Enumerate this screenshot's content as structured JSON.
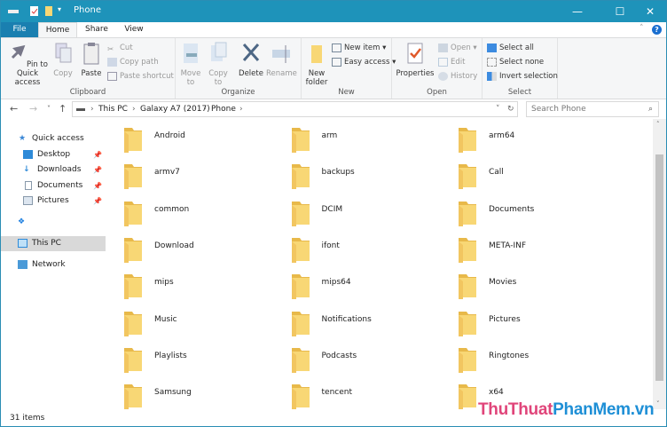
{
  "window": {
    "title": "Phone",
    "minimize": "—",
    "maximize": "☐",
    "close": "✕"
  },
  "ribbon_tabs": [
    "File",
    "Home",
    "Share",
    "View"
  ],
  "clipboard": {
    "group": "Clipboard",
    "pin": "Pin to Quick access",
    "copy": "Copy",
    "paste": "Paste",
    "cut": "Cut",
    "copy_path": "Copy path",
    "paste_shortcut": "Paste shortcut"
  },
  "organize": {
    "group": "Organize",
    "move_to": "Move to",
    "copy_to": "Copy to",
    "delete": "Delete",
    "rename": "Rename"
  },
  "new": {
    "group": "New",
    "new_folder": "New folder",
    "new_item": "New item ▾",
    "easy_access": "Easy access ▾"
  },
  "open": {
    "group": "Open",
    "properties": "Properties",
    "open": "Open ▾",
    "edit": "Edit",
    "history": "History"
  },
  "select": {
    "group": "Select",
    "select_all": "Select all",
    "select_none": "Select none",
    "invert": "Invert selection"
  },
  "address": {
    "crumbs": [
      "This PC",
      "Galaxy A7 (2017)",
      "Phone"
    ],
    "search_placeholder": "Search Phone"
  },
  "sidebar": {
    "quick_access": "Quick access",
    "items": [
      "Desktop",
      "Downloads",
      "Documents",
      "Pictures"
    ],
    "this_pc": "This PC",
    "network": "Network"
  },
  "folders": [
    "Android",
    "arm",
    "arm64",
    "armv7",
    "backups",
    "Call",
    "common",
    "DCIM",
    "Documents",
    "Download",
    "ifont",
    "META-INF",
    "mips",
    "mips64",
    "Movies",
    "Music",
    "Notifications",
    "Pictures",
    "Playlists",
    "Podcasts",
    "Ringtones",
    "Samsung",
    "tencent",
    "x64"
  ],
  "status": {
    "count": "31 items"
  },
  "watermark": {
    "part1": "ThuThuat",
    "part2": "PhanMem",
    "part3": ".vn"
  },
  "colors": {
    "titlebar": "#1e93ba",
    "folder": "#f8d775",
    "selected": "#d9d9d9"
  }
}
